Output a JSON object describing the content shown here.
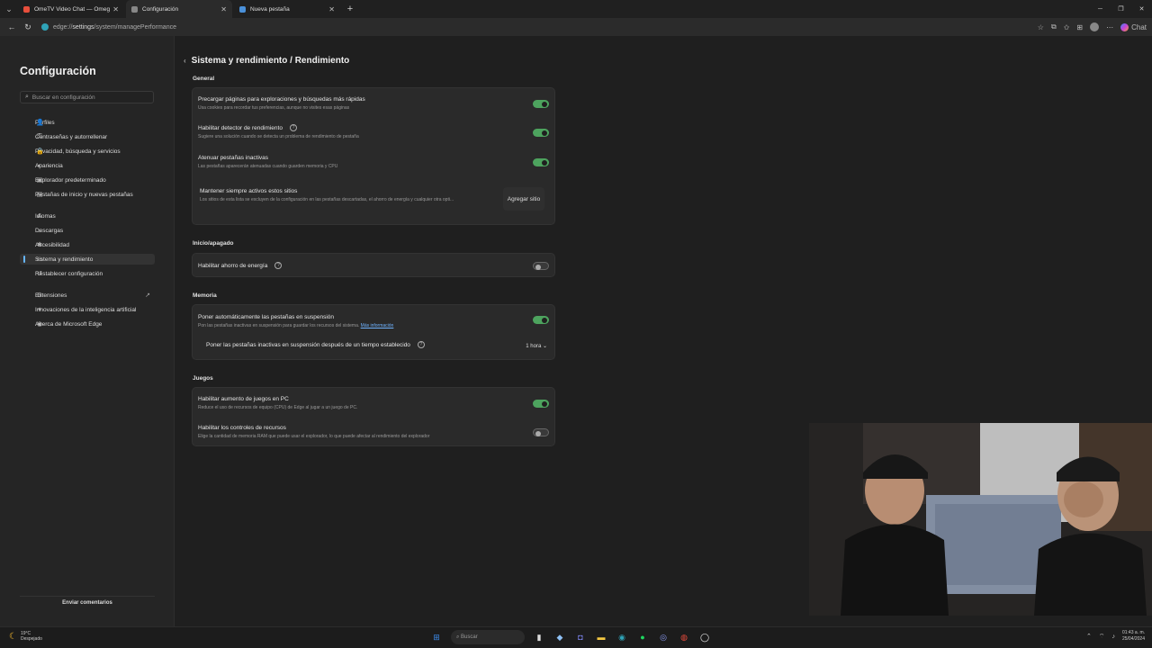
{
  "tabs": [
    {
      "label": "OmeTV Video Chat — Omegle Ra",
      "icon": "ometv-icon",
      "color": "#e84f3c",
      "active": false
    },
    {
      "label": "Configuración",
      "icon": "settings-icon",
      "color": "#888888",
      "active": true
    },
    {
      "label": "Nueva pestaña",
      "icon": "newtab-icon",
      "color": "#4a90d9",
      "active": false
    }
  ],
  "address": {
    "prefix": "edge://",
    "strong": "settings",
    "rest": "/system/managePerformance"
  },
  "toolbar": {
    "chat_label": "Chat"
  },
  "sidebar": {
    "title": "Configuración",
    "search_placeholder": "Buscar en configuración",
    "items": [
      {
        "label": "Perfiles",
        "icon": "profile-icon",
        "glyph": "👤"
      },
      {
        "label": "Contraseñas y autorrellenar",
        "icon": "key-icon",
        "glyph": "⚿"
      },
      {
        "label": "Privacidad, búsqueda y servicios",
        "icon": "lock-icon",
        "glyph": "🔒"
      },
      {
        "label": "Apariencia",
        "icon": "appearance-icon",
        "glyph": "◐"
      },
      {
        "label": "Explorador predeterminado",
        "icon": "browser-icon",
        "glyph": "▣"
      },
      {
        "label": "Pestañas de inicio y nuevas pestañas",
        "icon": "tabs-icon",
        "glyph": "▤"
      },
      {
        "label": "Idiomas",
        "icon": "language-icon",
        "glyph": "A"
      },
      {
        "label": "Descargas",
        "icon": "download-icon",
        "glyph": "↓"
      },
      {
        "label": "Accesibilidad",
        "icon": "accessibility-icon",
        "glyph": "✱"
      },
      {
        "label": "Sistema y rendimiento",
        "icon": "system-icon",
        "glyph": "▭"
      },
      {
        "label": "Restablecer configuración",
        "icon": "reset-icon",
        "glyph": "↺"
      },
      {
        "label": "Extensiones",
        "icon": "extensions-icon",
        "glyph": "⚙"
      },
      {
        "label": "Innovaciones de la inteligencia artificial",
        "icon": "ai-icon",
        "glyph": "✦"
      },
      {
        "label": "Acerca de Microsoft Edge",
        "icon": "edge-icon",
        "glyph": "◉"
      }
    ],
    "feedback": "Enviar comentarios"
  },
  "main": {
    "breadcrumb": "Sistema y rendimiento  /  Rendimiento",
    "general": {
      "title": "General",
      "preload": {
        "title": "Precargar páginas para exploraciones y búsquedas más rápidas",
        "desc": "Usa cookies para recordar tus preferencias, aunque no visites esas páginas",
        "on": true
      },
      "detector": {
        "title": "Habilitar detector de rendimiento",
        "desc": "Sugiere una solución cuando se detecta un problema de rendimiento de pestaña",
        "on": true
      },
      "fade": {
        "title": "Atenuar pestañas inactivas",
        "desc": "Las pestañas aparecerán atenuadas cuando guarden memoria y CPU",
        "on": true
      },
      "keep_active": {
        "title": "Mantener siempre activos estos sitios",
        "desc": "Los sitios de esta lista se excluyen de la configuración en las pestañas descartadas, el ahorro de energía y cualquier otra opti...",
        "button": "Agregar sitio"
      }
    },
    "power": {
      "title": "Inicio/apagado",
      "saver": {
        "title": "Habilitar ahorro de energía",
        "on": false
      }
    },
    "memory": {
      "title": "Memoria",
      "sleep": {
        "title": "Poner automáticamente las pestañas en suspensión",
        "desc": "Pon las pestañas inactivas en suspensión para guardar los recursos del sistema.",
        "link": "Más información",
        "on": true
      },
      "after": {
        "title": "Poner las pestañas inactivas en suspensión después de un tiempo establecido",
        "value": "1 hora"
      }
    },
    "games": {
      "title": "Juegos",
      "boost": {
        "title": "Habilitar aumento de juegos en PC",
        "desc": "Reduce el uso de recursos de equipo (CPU) de Edge al jugar a un juego de PC.",
        "on": true
      },
      "controls": {
        "title": "Habilitar los controles de recursos",
        "desc": "Elige la cantidad de memoria RAM que puede usar el explorador, lo que puede afectar al rendimiento del explorador",
        "on": false
      }
    }
  },
  "taskbar": {
    "weather_temp": "19°C",
    "weather_desc": "Despejado",
    "search_placeholder": "Buscar",
    "time": "01:43 a. m.",
    "date": "25/04/2024"
  }
}
